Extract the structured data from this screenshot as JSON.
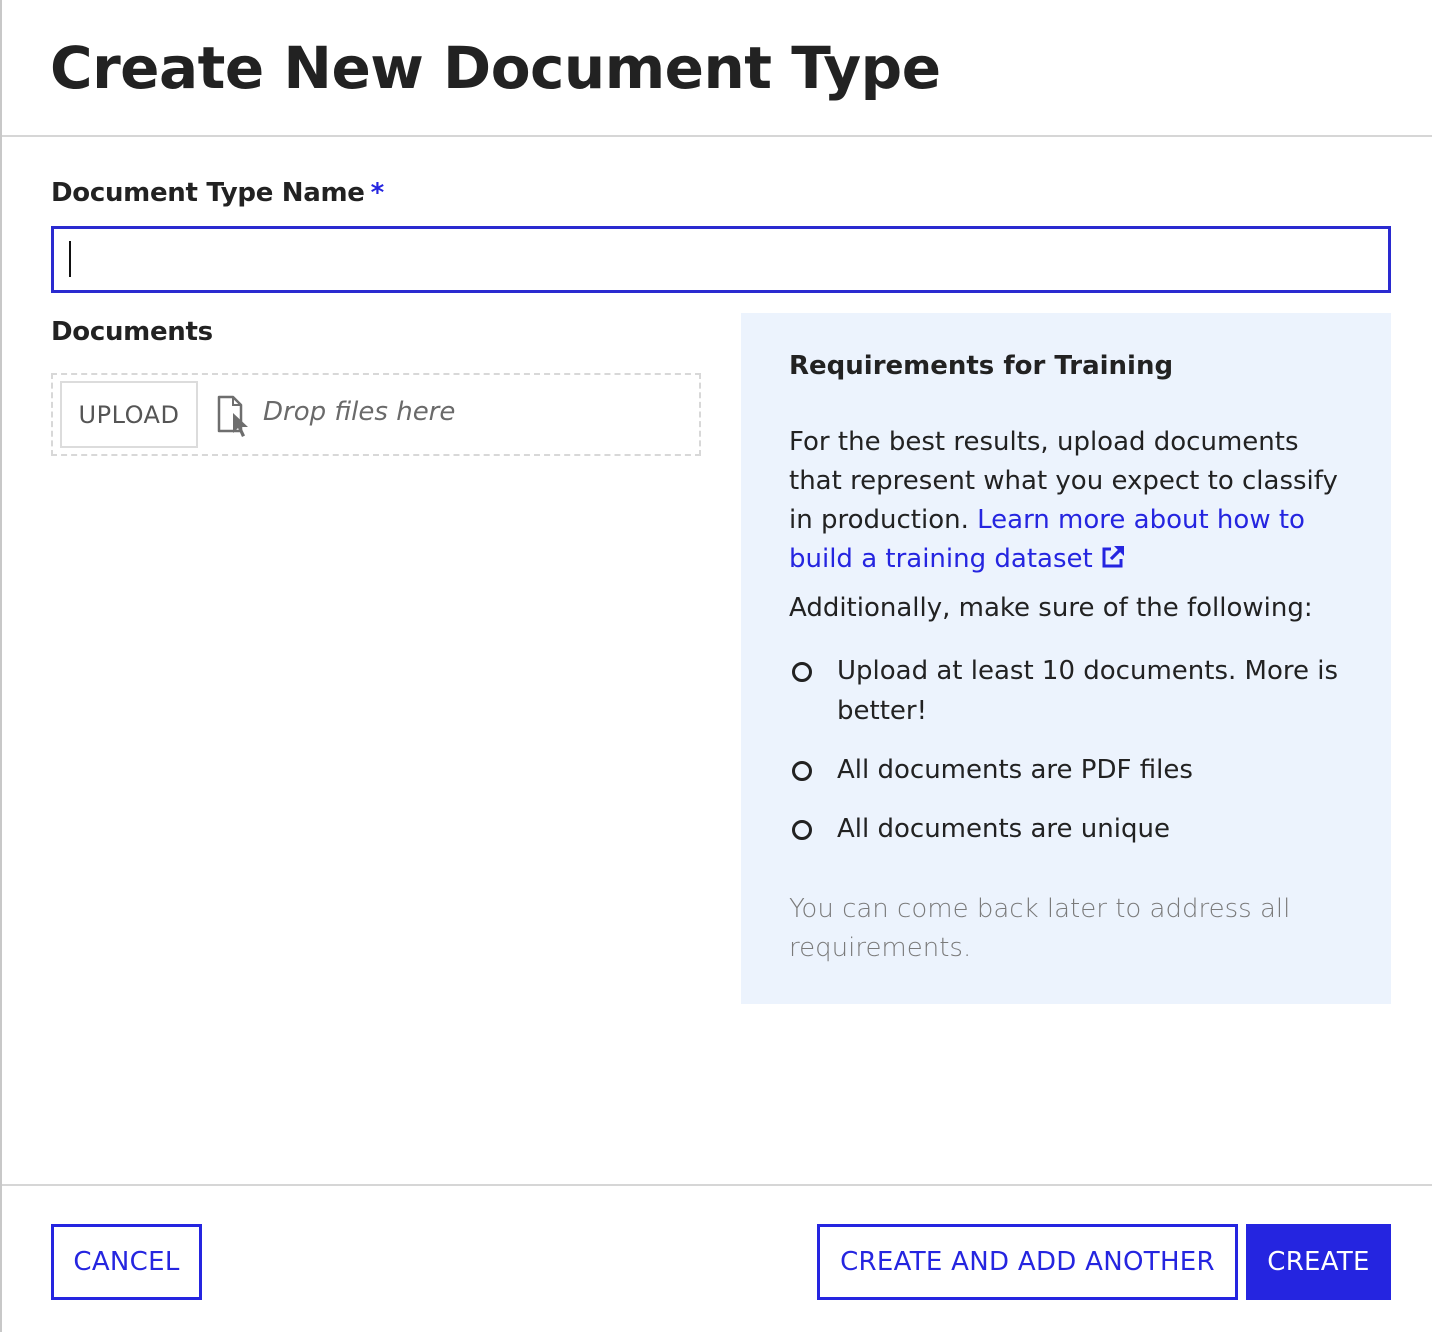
{
  "dialog": {
    "title": "Create New Document Type"
  },
  "form": {
    "name_label": "Document Type Name",
    "required_marker": "*",
    "name_value": "",
    "name_placeholder": "",
    "documents_label": "Documents",
    "upload_label": "UPLOAD",
    "drop_text": "Drop files here",
    "drop_icon": "file-drop-cursor-icon"
  },
  "requirements": {
    "title": "Requirements for Training",
    "intro": "For the best results, upload documents that represent what you expect to classify in production. ",
    "link_text": "Learn more about how to build a training dataset",
    "link_icon": "external-link-icon",
    "subheading": "Additionally, make sure of the following:",
    "items": [
      {
        "text": "Upload at least 10 documents. More is better!",
        "status": "incomplete"
      },
      {
        "text": "All documents are PDF files",
        "status": "incomplete"
      },
      {
        "text": "All documents are unique",
        "status": "incomplete"
      }
    ],
    "note": "You can come back later to address all requirements."
  },
  "footer": {
    "cancel_label": "CANCEL",
    "create_another_label": "CREATE AND ADD ANOTHER",
    "create_label": "CREATE"
  },
  "colors": {
    "accent": "#2525e0",
    "panel_bg": "#ecf3fd",
    "text": "#222222",
    "muted": "#7a7a7a"
  }
}
